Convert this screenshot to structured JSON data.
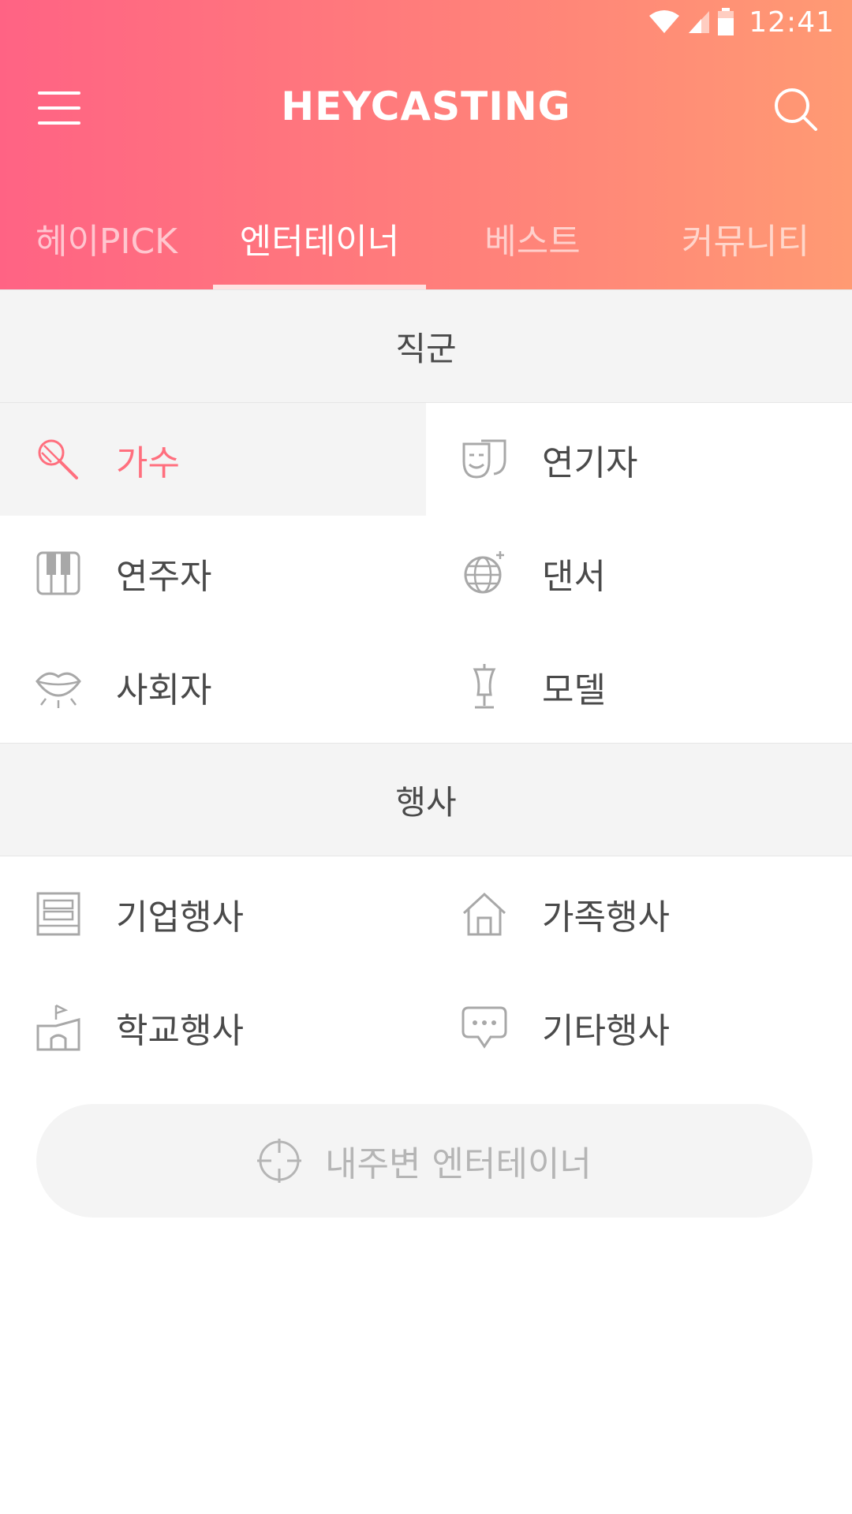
{
  "status_bar": {
    "time": "12:41",
    "icons": [
      "wifi-icon",
      "signal-icon",
      "battery-icon"
    ]
  },
  "app": {
    "title": "HEYCASTING",
    "menu_icon": "hamburger-menu-icon",
    "search_icon": "search-icon"
  },
  "tabs": [
    {
      "label": "헤이PICK",
      "active": false
    },
    {
      "label": "엔터테이너",
      "active": true
    },
    {
      "label": "베스트",
      "active": false
    },
    {
      "label": "커뮤니티",
      "active": false
    }
  ],
  "sections": {
    "job": {
      "title": "직군",
      "items": [
        {
          "label": "가수",
          "icon": "microphone-icon",
          "selected": true
        },
        {
          "label": "연기자",
          "icon": "theater-masks-icon",
          "selected": false
        },
        {
          "label": "연주자",
          "icon": "piano-keys-icon",
          "selected": false
        },
        {
          "label": "댄서",
          "icon": "disco-ball-icon",
          "selected": false
        },
        {
          "label": "사회자",
          "icon": "lips-icon",
          "selected": false
        },
        {
          "label": "모델",
          "icon": "mannequin-icon",
          "selected": false
        }
      ]
    },
    "event": {
      "title": "행사",
      "items": [
        {
          "label": "기업행사",
          "icon": "building-icon"
        },
        {
          "label": "가족행사",
          "icon": "house-icon"
        },
        {
          "label": "학교행사",
          "icon": "school-icon"
        },
        {
          "label": "기타행사",
          "icon": "chat-bubble-icon"
        }
      ]
    }
  },
  "nearby": {
    "label": "내주변 엔터테이너",
    "icon": "crosshair-icon"
  },
  "colors": {
    "accent": "#ff6f7e",
    "gradient_start": "#ff6384",
    "gradient_end": "#ff9a73",
    "section_bg": "#f4f4f4",
    "icon_gray": "#a8a8a8"
  }
}
